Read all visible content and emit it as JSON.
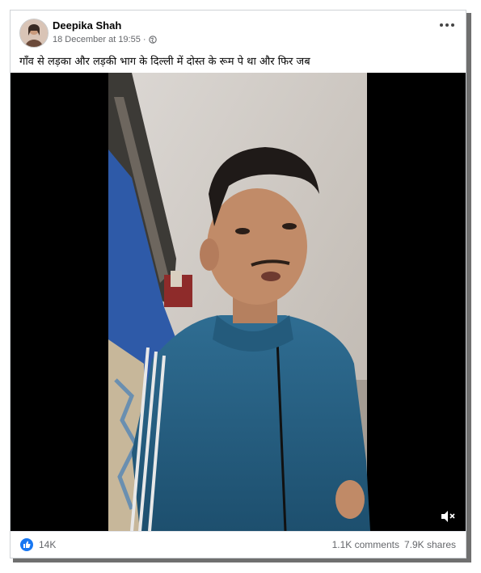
{
  "post": {
    "author": "Deepika Shah",
    "timestamp": "18 December at 19:55",
    "separator": "·",
    "privacy_icon": "globe-icon",
    "caption": "गाँव से लड़का और लड़की भाग के दिल्ली में दोस्त के रूम पे था और फिर जब"
  },
  "video": {
    "mute_icon": "speaker-muted-icon"
  },
  "footer": {
    "reactions": "14K",
    "comments": "1.1K comments",
    "shares": "7.9K shares"
  },
  "colors": {
    "accent": "#1877f2",
    "secondary_text": "#65676b"
  }
}
